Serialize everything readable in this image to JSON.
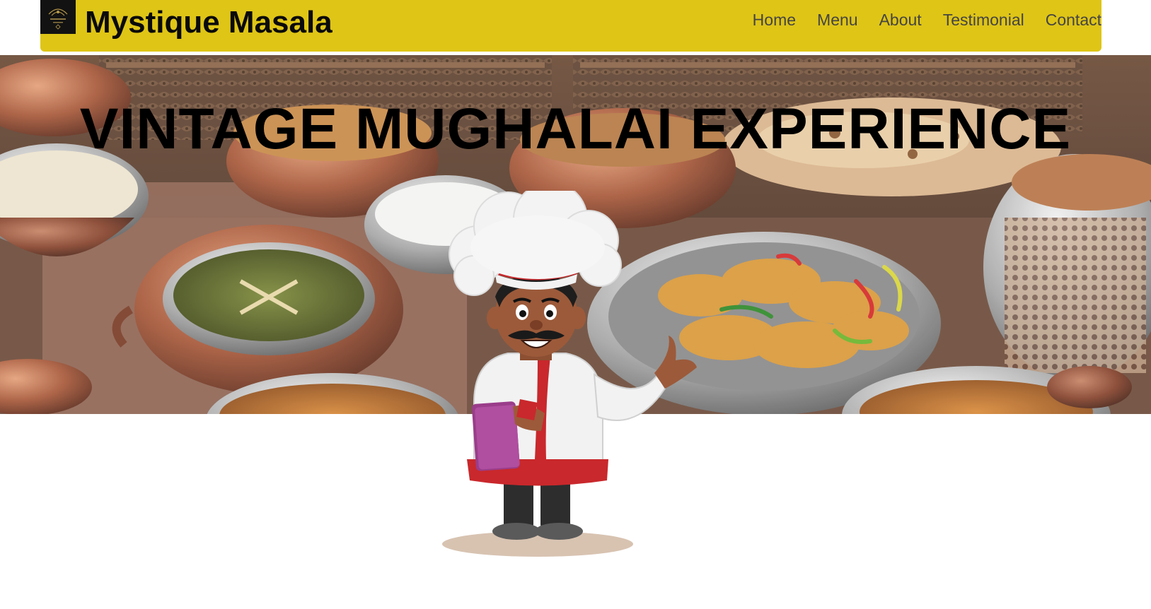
{
  "header": {
    "brand": "Mystique Masala",
    "logo_icon": "restaurant-logo-icon",
    "nav": [
      {
        "label": "Home"
      },
      {
        "label": "Menu"
      },
      {
        "label": "About"
      },
      {
        "label": "Testimonial"
      },
      {
        "label": "Contact"
      }
    ]
  },
  "hero": {
    "title": "VINTAGE MUGHALAI EXPERIENCE",
    "background": "mughlai-food-copper-bowls-image",
    "mascot": "chef-mascot-illustration"
  },
  "colors": {
    "navbar_bg": "#dfc516",
    "nav_text": "#444444",
    "brand_text": "#0a0a0a"
  }
}
